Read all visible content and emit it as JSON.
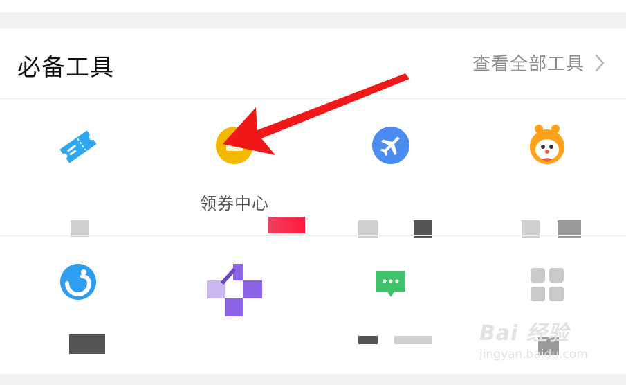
{
  "header": {
    "title": "必备工具",
    "view_all_label": "查看全部工具"
  },
  "tools": {
    "row1": [
      {
        "label": "",
        "icon": "ticket-icon",
        "color": "#2fa6f0"
      },
      {
        "label": "领券中心",
        "icon": "coupon-icon",
        "color": "#f5b800"
      },
      {
        "label": "",
        "icon": "airplane-icon",
        "color": "#4a8cf0"
      },
      {
        "label": "",
        "icon": "clown-face-icon",
        "color": "#ffa21a"
      }
    ],
    "row2": [
      {
        "label": "",
        "icon": "swirl-icon",
        "color": "#2f9df0"
      },
      {
        "label": "",
        "icon": "puzzle-icon",
        "color": "#8b63e6"
      },
      {
        "label": "",
        "icon": "chat-bubble-icon",
        "color": "#3fc26a"
      },
      {
        "label": "",
        "icon": "grid-icon",
        "color": "#c9c9c9"
      }
    ]
  },
  "annotation": {
    "color": "#f01818"
  },
  "watermark": {
    "brand": "Bai 经验",
    "url": "jingyan.baidu.com"
  }
}
